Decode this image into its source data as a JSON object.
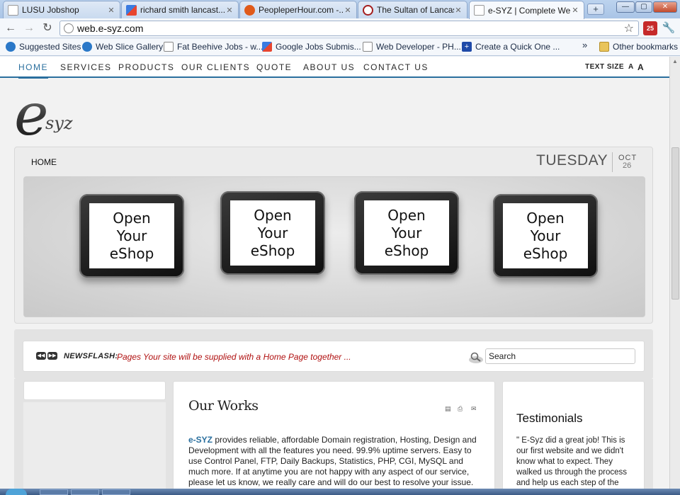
{
  "browser": {
    "tabs": [
      {
        "title": "LUSU Jobshop",
        "icon": "page-icon",
        "color": "#ffffff"
      },
      {
        "title": "richard smith lancast...",
        "icon": "google-icon",
        "color": "#3a7be0"
      },
      {
        "title": "PeopleperHour.com -...",
        "icon": "peopleperhour-icon",
        "color": "#e05a1a"
      },
      {
        "title": "The Sultan of Lancast...",
        "icon": "sultan-icon",
        "color": "#a31e1e"
      },
      {
        "title": "e-SYZ | Complete We...",
        "icon": "page-icon",
        "color": "#ffffff"
      }
    ],
    "new_tab": "+",
    "window_buttons": {
      "minimize": "—",
      "maximize": "▢",
      "close": "✕"
    },
    "url": "web.e-syz.com",
    "extension_badge": "25",
    "bookmarks": [
      {
        "label": "Suggested Sites",
        "icon": "ie-icon"
      },
      {
        "label": "Web Slice Gallery",
        "icon": "ie-icon"
      },
      {
        "label": "Fat Beehive Jobs - w...",
        "icon": "page-icon"
      },
      {
        "label": "Google Jobs Submis...",
        "icon": "google-icon"
      },
      {
        "label": "Web Developer - PH...",
        "icon": "page-icon"
      },
      {
        "label": "Create a Quick One ...",
        "icon": "plus-icon"
      }
    ],
    "bookmarks_overflow": "»",
    "other_bookmarks": "Other bookmarks"
  },
  "nav": {
    "items": [
      "HOME",
      "SERVICES",
      "PRODUCTS",
      "OUR CLIENTS",
      "QUOTE",
      "ABOUT US",
      "CONTACT US"
    ],
    "text_size_label": "TEXT SIZE",
    "text_size_small": "A",
    "text_size_large": "A"
  },
  "logo": {
    "text": "e",
    "suffix": "syz"
  },
  "header": {
    "breadcrumb": "HOME",
    "day": "TUESDAY",
    "month": "OCT",
    "date": "26"
  },
  "banner": {
    "tablets": [
      [
        "Open",
        "Your",
        "eShop"
      ],
      [
        "Open",
        "Your",
        "eShop"
      ],
      [
        "Open",
        "Your",
        "eShop"
      ],
      [
        "Open",
        "Your",
        "eShop"
      ]
    ]
  },
  "newsflash": {
    "prev": "◀◀",
    "next": "▶▶",
    "label": "NEWSFLASH:",
    "text": "Pages Your site will be supplied with a Home Page together ...",
    "search_value": "Search"
  },
  "works": {
    "title": "Our Works",
    "brand": "e-SYZ",
    "body": " provides reliable, affordable Domain registration, Hosting, Design and Development with all the features you need. 99.9% uptime servers. Easy to use Control Panel, FTP, Daily Backups, Statistics, PHP, CGI, MySQL and much more. If at anytime you are not happy with any aspect of our service, please let us know, we really care and will do our best to resolve your issue."
  },
  "testimonials": {
    "title": "Testimonials",
    "text": "\" E-Syz did a great job! This is our first website and we didn't know what to expect. They walked us through the process and help us each step of the"
  },
  "colors": {
    "accent": "#2a6f9e",
    "newsflash": "#b01010"
  }
}
